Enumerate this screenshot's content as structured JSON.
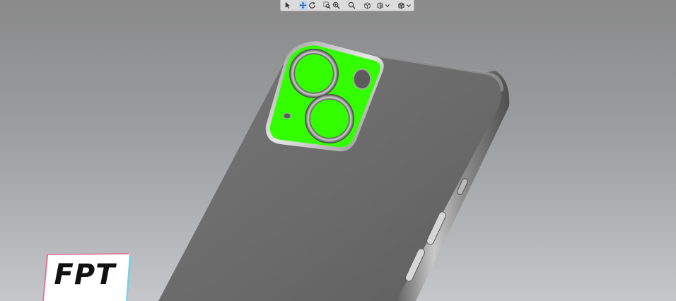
{
  "toolbar": {
    "tools": [
      {
        "name": "select",
        "icon": "cursor-arrow-icon"
      },
      {
        "name": "pan",
        "icon": "pan-arrows-icon"
      },
      {
        "name": "orbit",
        "icon": "rotate-icon"
      },
      {
        "name": "zoom-window",
        "icon": "zoom-window-icon"
      },
      {
        "name": "zoom",
        "icon": "zoom-magnifier-icon"
      },
      {
        "name": "zoom-fit",
        "icon": "zoom-fit-icon"
      },
      {
        "name": "standard-views",
        "icon": "cube-view-icon"
      },
      {
        "name": "section-view",
        "icon": "section-cube-icon"
      },
      {
        "name": "display-style",
        "icon": "shaded-cube-icon"
      }
    ],
    "active_tool": "pan"
  },
  "model": {
    "body_color": "#6f6f6f",
    "highlight_color": "#33ff00"
  },
  "watermark": {
    "text": "FPT",
    "glow_left": "#ff3b6b",
    "glow_right": "#34e0ff"
  }
}
